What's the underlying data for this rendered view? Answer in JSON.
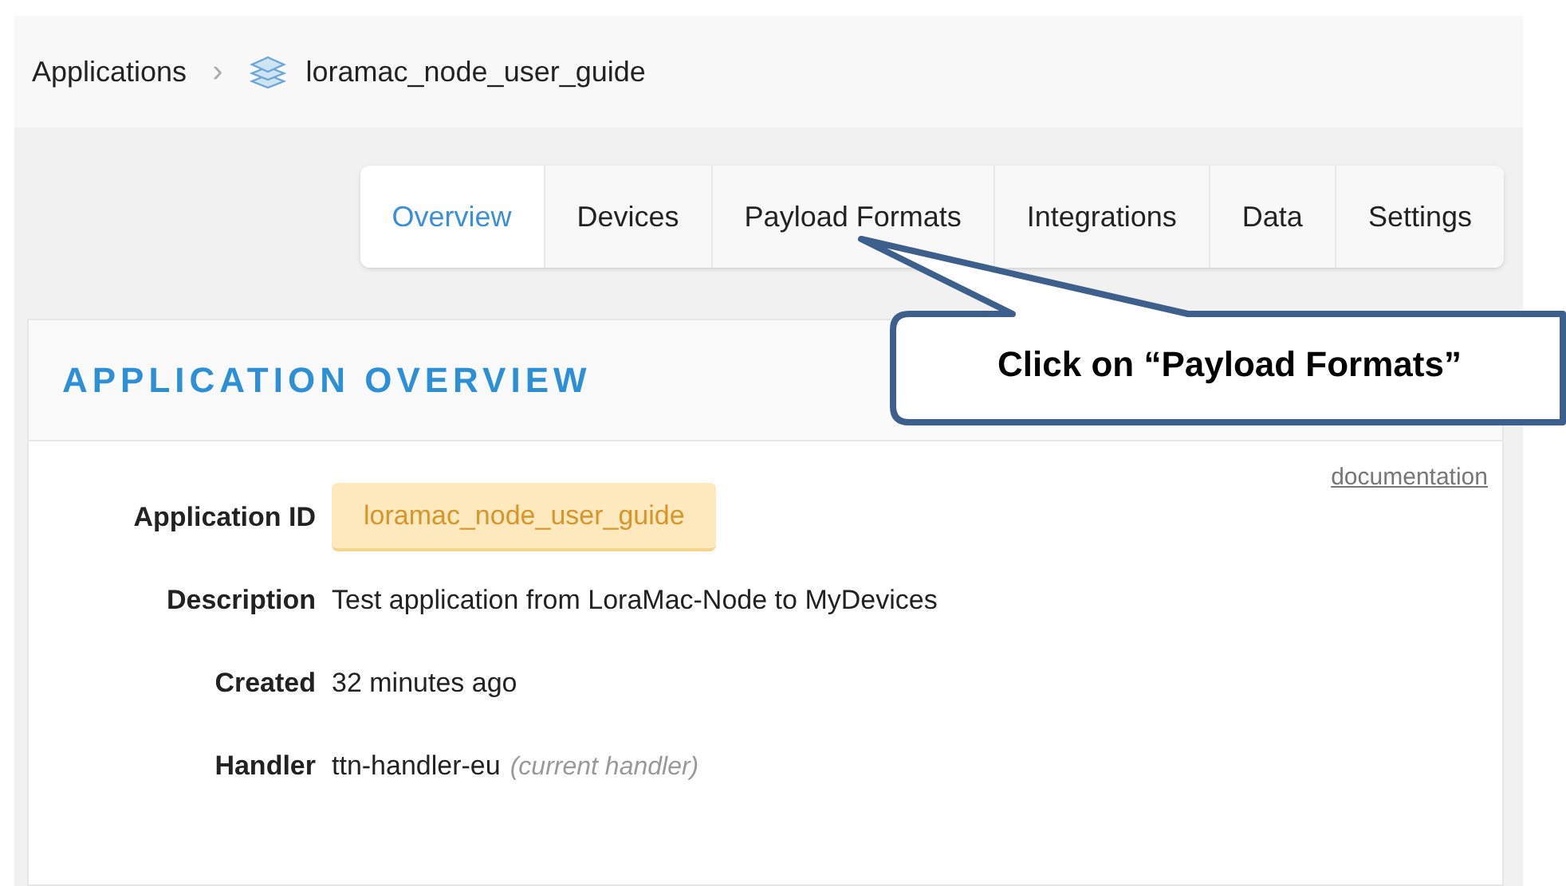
{
  "breadcrumb": {
    "root": "Applications",
    "separator": "›",
    "current": "loramac_node_user_guide"
  },
  "tabs": [
    {
      "label": "Overview",
      "selected": true
    },
    {
      "label": "Devices",
      "selected": false
    },
    {
      "label": "Payload Formats",
      "selected": false
    },
    {
      "label": "Integrations",
      "selected": false
    },
    {
      "label": "Data",
      "selected": false
    },
    {
      "label": "Settings",
      "selected": false
    }
  ],
  "card": {
    "title": "APPLICATION OVERVIEW",
    "link": "documentation",
    "fields": [
      {
        "label": "Application ID",
        "kind": "badge",
        "value": "loramac_node_user_guide"
      },
      {
        "label": "Description",
        "kind": "text",
        "value": "Test application from LoraMac-Node to MyDevices"
      },
      {
        "label": "Created",
        "kind": "text",
        "value": "32 minutes ago"
      },
      {
        "label": "Handler",
        "kind": "text",
        "value": "ttn-handler-eu",
        "note": "(current handler)"
      }
    ]
  },
  "callout": {
    "text": "Click on “Payload Formats”"
  }
}
